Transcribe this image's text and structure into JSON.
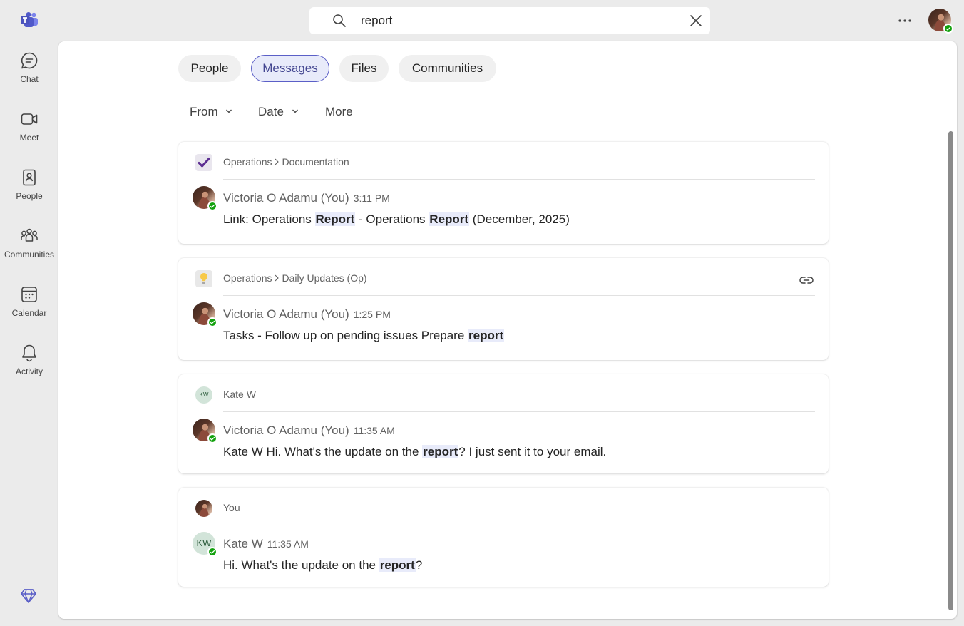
{
  "rail": {
    "items": [
      {
        "label": "Chat",
        "icon": "chat-icon"
      },
      {
        "label": "Meet",
        "icon": "video-camera-icon"
      },
      {
        "label": "People",
        "icon": "contact-book-icon"
      },
      {
        "label": "Communities",
        "icon": "communities-icon"
      },
      {
        "label": "Calendar",
        "icon": "calendar-icon"
      },
      {
        "label": "Activity",
        "icon": "bell-icon"
      }
    ]
  },
  "search": {
    "query": "report"
  },
  "tabs": [
    {
      "label": "People",
      "active": false
    },
    {
      "label": "Messages",
      "active": true
    },
    {
      "label": "Files",
      "active": false
    },
    {
      "label": "Communities",
      "active": false
    }
  ],
  "filters": {
    "from": "From",
    "date": "Date",
    "more": "More"
  },
  "results": [
    {
      "context_team": "Operations",
      "context_channel": "Documentation",
      "context_icon": "checkmark-app-icon",
      "sender": "Victoria O Adamu (You)",
      "time": "3:11 PM",
      "body": [
        {
          "text": "Link: Operations ",
          "hl": false
        },
        {
          "text": "Report",
          "hl": true
        },
        {
          "text": " - Operations ",
          "hl": false
        },
        {
          "text": "Report",
          "hl": true
        },
        {
          "text": " (December, 2025)",
          "hl": false
        }
      ]
    },
    {
      "context_team": "Operations",
      "context_channel": "Daily Updates (Op)",
      "context_icon": "lightbulb-icon",
      "sender": "Victoria O Adamu (You)",
      "time": "1:25 PM",
      "body": [
        {
          "text": "Tasks - Follow up on pending issues Prepare ",
          "hl": false
        },
        {
          "text": "report",
          "hl": true
        }
      ]
    },
    {
      "context_name": "Kate W",
      "context_initials": "KW",
      "sender": "Victoria O Adamu (You)",
      "time": "11:35 AM",
      "body": [
        {
          "text": "Kate W Hi. What's the update on the ",
          "hl": false
        },
        {
          "text": "report",
          "hl": true
        },
        {
          "text": "? I just sent it to your email.",
          "hl": false
        }
      ]
    },
    {
      "context_name": "You",
      "sender": "Kate W",
      "sender_initials": "KW",
      "time": "11:35 AM",
      "body": [
        {
          "text": "Hi. What's the update on the ",
          "hl": false
        },
        {
          "text": "report",
          "hl": true
        },
        {
          "text": "?",
          "hl": false
        }
      ]
    }
  ],
  "colors": {
    "accent": "#5b5fc7",
    "accent_bg": "#e8ebfa",
    "presence_available": "#13a10e",
    "rail_background": "#ebebeb"
  }
}
